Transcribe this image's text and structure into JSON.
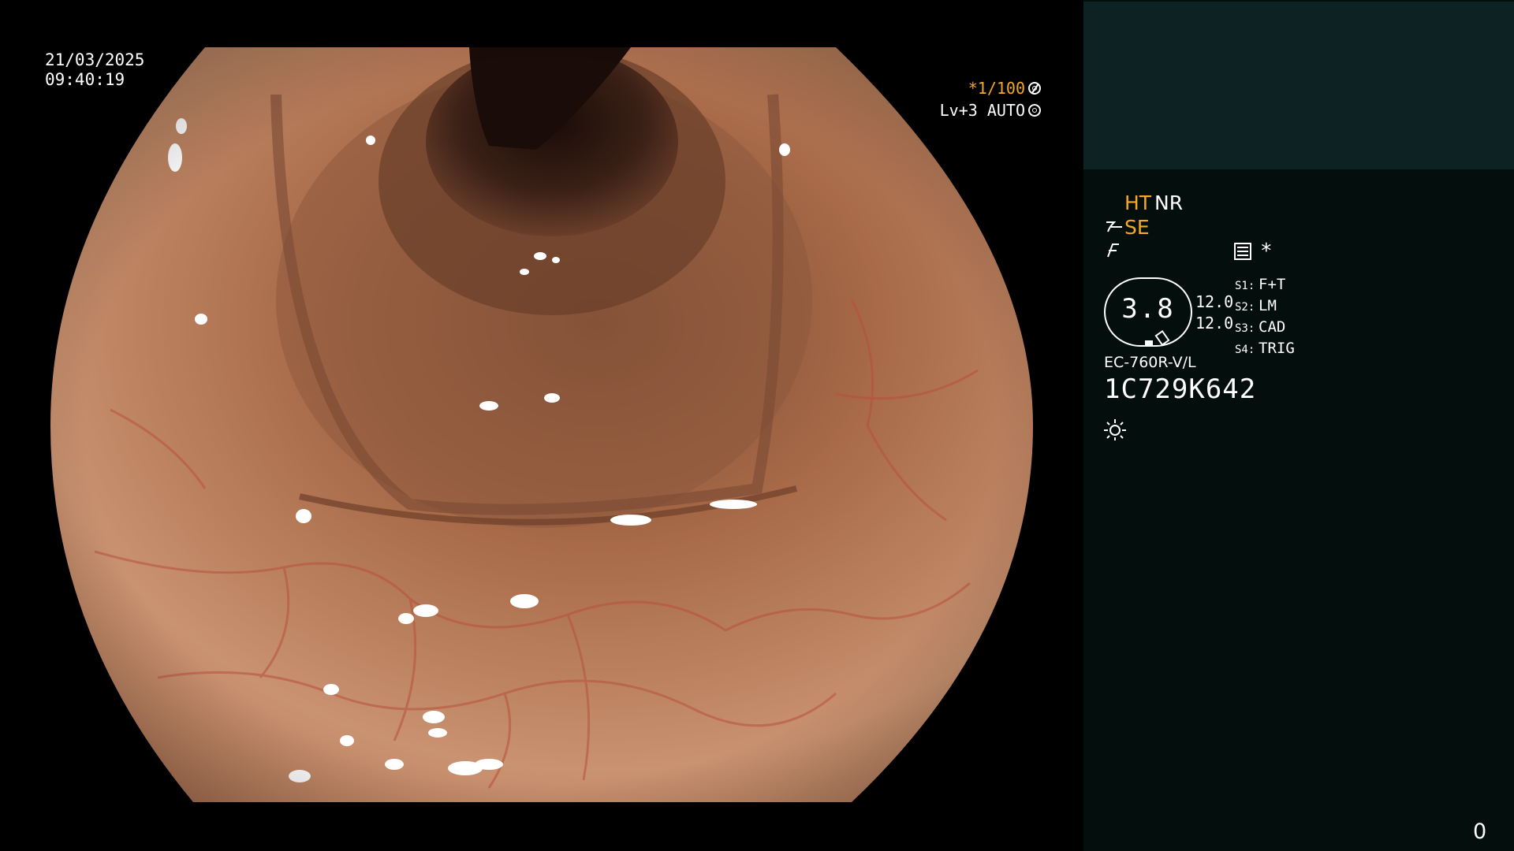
{
  "overlay": {
    "date": "21/03/2025",
    "time": "09:40:19",
    "shutter_speed": "*1/100",
    "exposure": "Lv+3 AUTO"
  },
  "status": {
    "ht": "HT",
    "nr": "NR",
    "se": "SE"
  },
  "gauge": {
    "value": "3.8",
    "num_top": "12.0",
    "num_bottom": "12.0"
  },
  "switches": [
    {
      "key": "S1:",
      "value": "F+T"
    },
    {
      "key": "S2:",
      "value": "LM"
    },
    {
      "key": "S3:",
      "value": "CAD"
    },
    {
      "key": "S4:",
      "value": "TRIG"
    }
  ],
  "scope": {
    "model": "EC-760R-V/L",
    "serial": "1C729K642"
  },
  "counter": "0",
  "colors": {
    "accent": "#f2a928",
    "panel_top": "#0d2323",
    "panel": "#040f0d"
  },
  "icons": [
    "aperture-icon",
    "camera-icon",
    "bend-icon",
    "pen-icon",
    "histogram-icon",
    "asterisk-icon",
    "light-icon"
  ]
}
